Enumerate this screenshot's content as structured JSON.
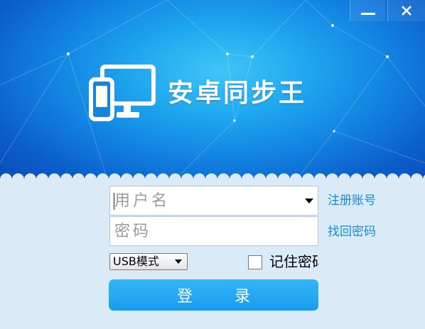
{
  "window": {
    "minimize_label": "minimize",
    "close_label": "close"
  },
  "app": {
    "title": "安卓同步王",
    "icon": "device-sync-logo-icon",
    "accent": "#1a9cf0"
  },
  "login": {
    "username_placeholder": "用户名",
    "password_placeholder": "密码",
    "register_link": "注册账号",
    "find_password_link": "找回密码",
    "mode_select_value": "USB模式",
    "remember_label": "记住密码",
    "login_button": "登 录"
  }
}
